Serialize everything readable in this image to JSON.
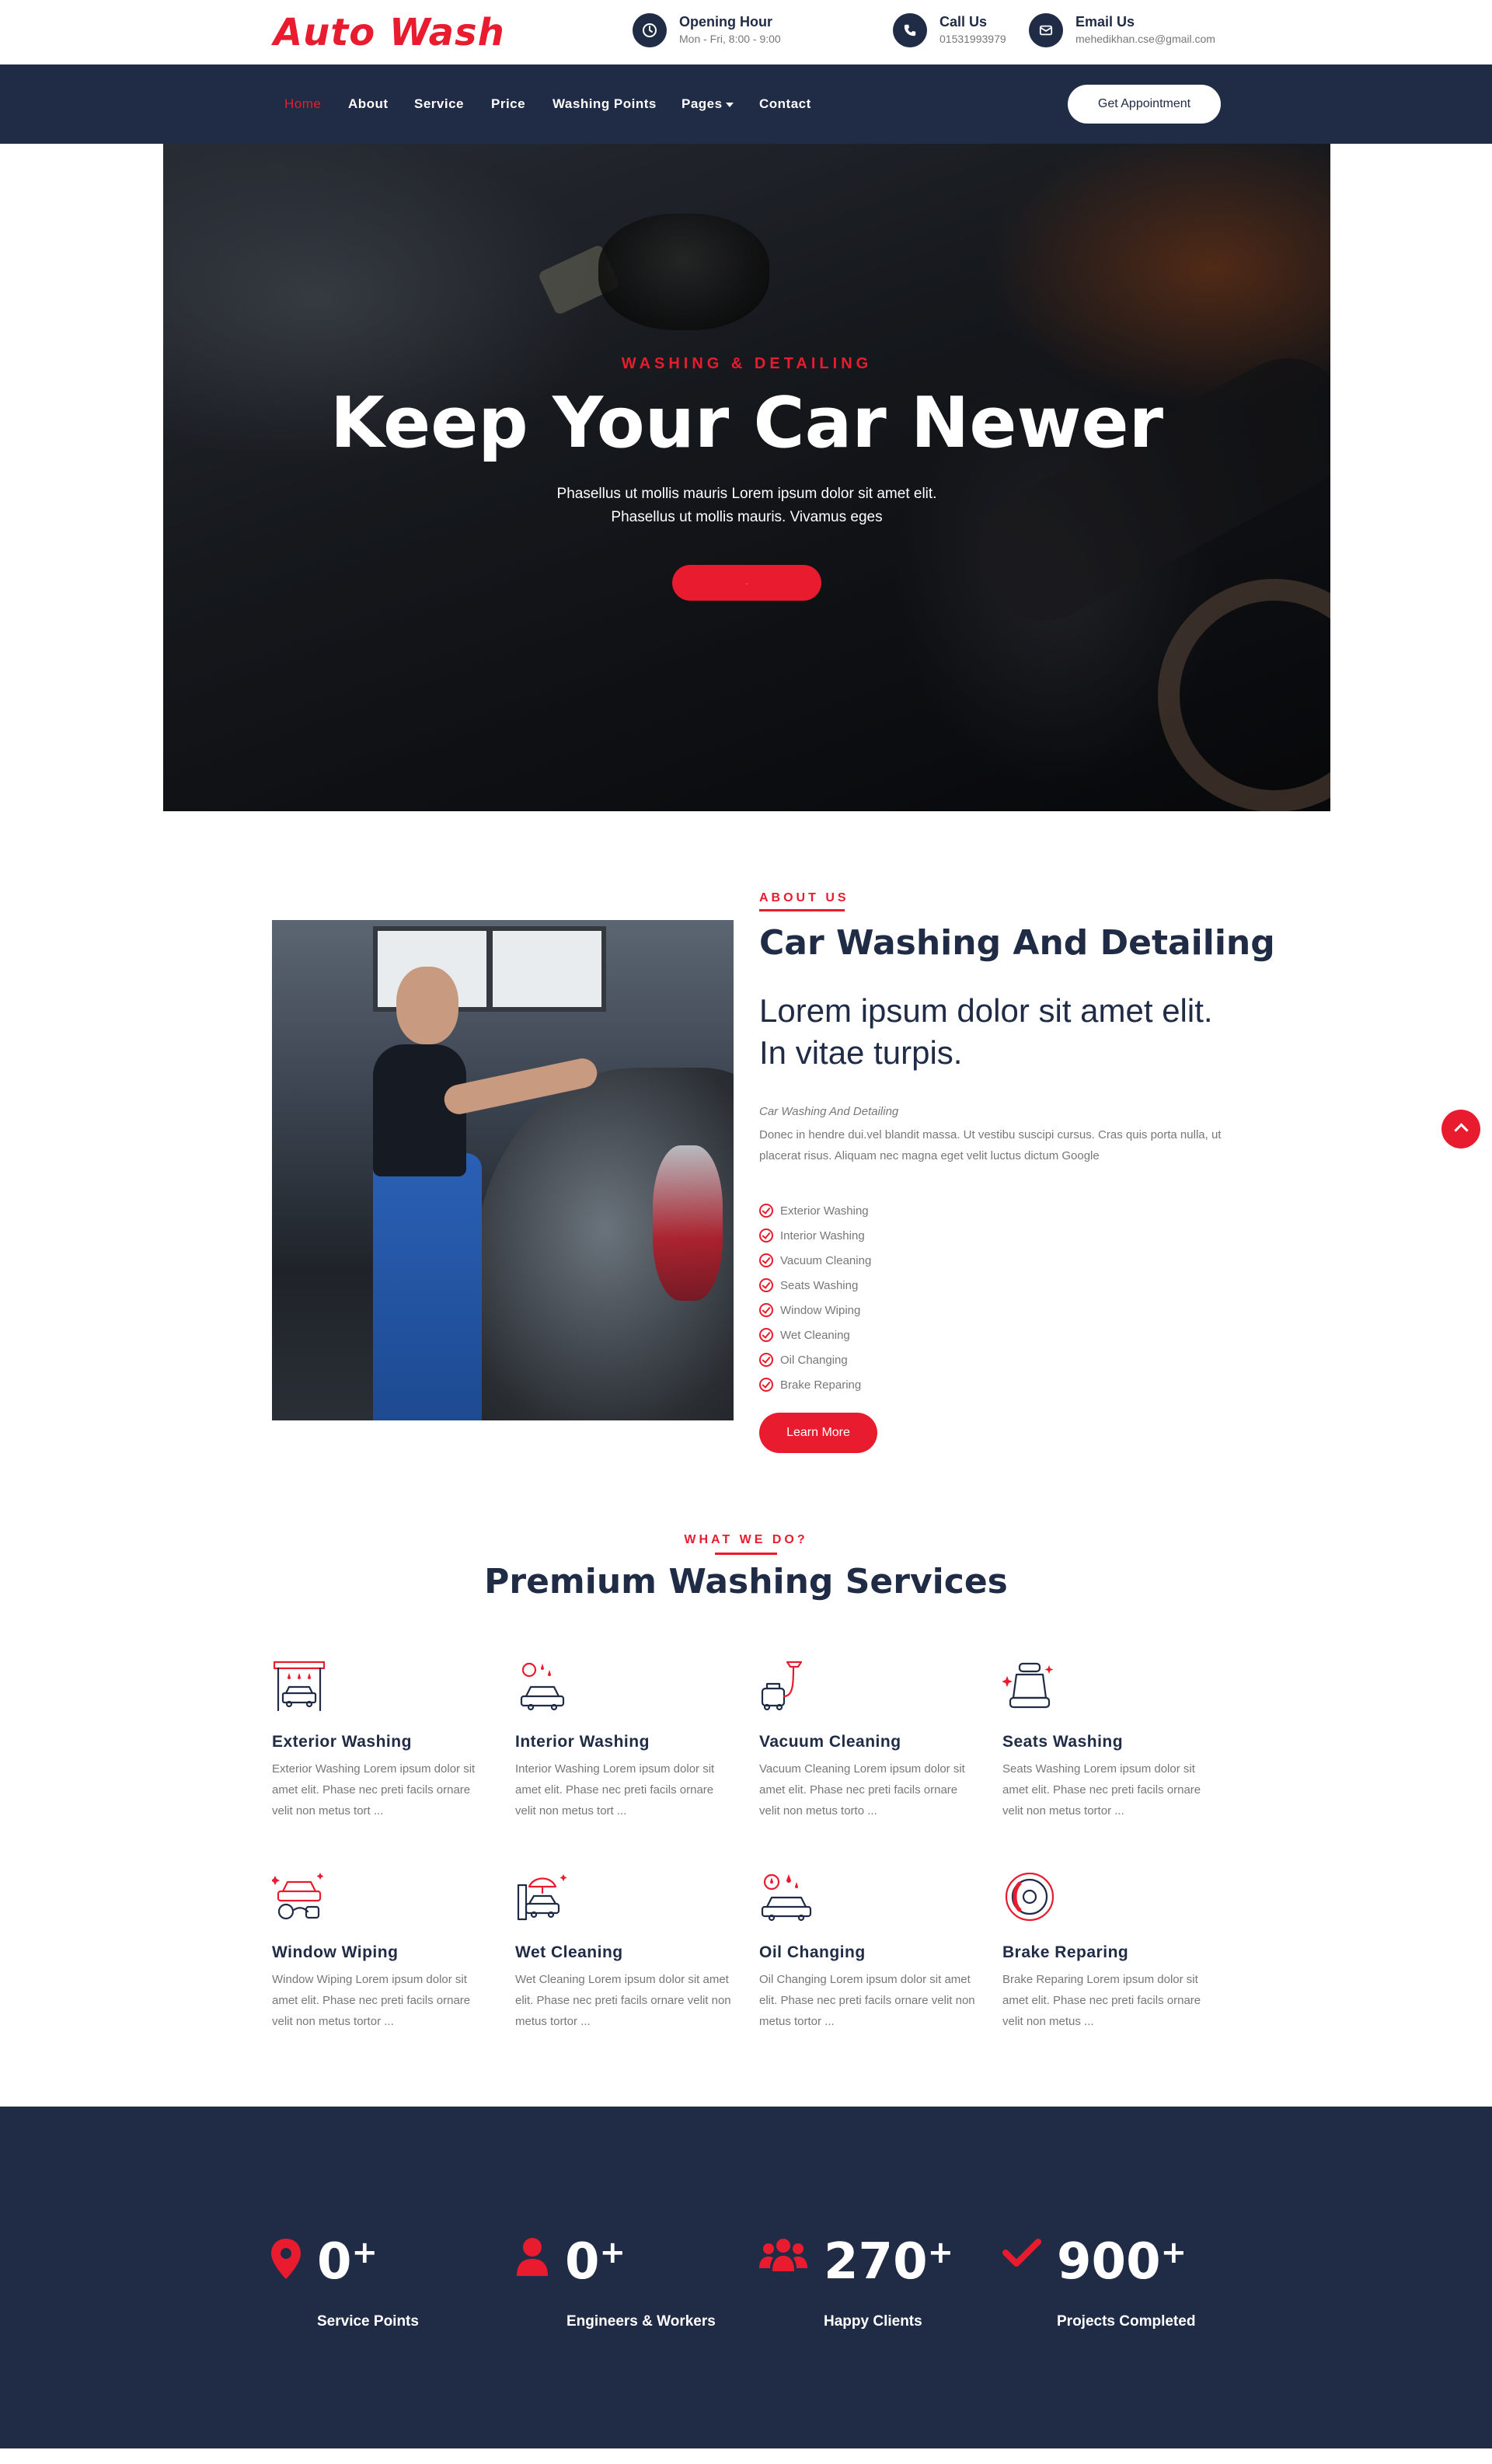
{
  "brand": {
    "logo": "Auto Wash",
    "accent": "#e81c2e",
    "navy": "#202c45"
  },
  "topbar": {
    "opening": {
      "title": "Opening Hour",
      "value": "Mon - Fri, 8:00 - 9:00",
      "icon": "clock-icon"
    },
    "call": {
      "title": "Call Us",
      "value": "01531993979",
      "icon": "phone-icon"
    },
    "email": {
      "title": "Email Us",
      "value": "mehedikhan.cse@gmail.com",
      "icon": "envelope-icon"
    }
  },
  "nav": {
    "items": [
      "Home",
      "About",
      "Service",
      "Price",
      "Washing Points",
      "Pages",
      "Contact"
    ],
    "active": "Home",
    "cta": "Get Appointment"
  },
  "hero": {
    "eyebrow": "WASHING & DETAILING",
    "title": "Keep Your Car Newer",
    "text_line1": "Phasellus ut mollis mauris Lorem ipsum dolor sit amet elit.",
    "text_line2": "Phasellus ut mollis mauris. Vivamus eges",
    "button": "."
  },
  "about": {
    "eyebrow": "ABOUT US",
    "title": "Car Washing And Detailing",
    "lead": "Lorem ipsum dolor sit amet elit. In vitae turpis.",
    "caption": "Car Washing And Detailing",
    "body": "Donec in hendre dui.vel blandit massa. Ut vestibu suscipi cursus. Cras quis porta nulla, ut placerat risus. Aliquam nec magna eget velit luctus dictum Google",
    "checklist": [
      "Exterior Washing",
      "Interior Washing",
      "Vacuum Cleaning",
      "Seats Washing",
      "Window Wiping",
      "Wet Cleaning",
      "Oil Changing",
      "Brake Reparing"
    ],
    "button": "Learn More"
  },
  "services": {
    "eyebrow": "WHAT WE DO?",
    "title": "Premium Washing Services",
    "items": [
      {
        "name": "Exterior Washing",
        "desc": "Exterior Washing Lorem ipsum dolor sit amet elit. Phase nec preti facils ornare velit non metus tort ...",
        "icon": "car-wash-station-icon"
      },
      {
        "name": "Interior Washing",
        "desc": "Interior Washing Lorem ipsum dolor sit amet elit. Phase nec preti facils ornare velit non metus tort ...",
        "icon": "car-interior-icon"
      },
      {
        "name": "Vacuum Cleaning",
        "desc": "Vacuum Cleaning Lorem ipsum dolor sit amet elit. Phase nec preti facils ornare velit non metus torto ...",
        "icon": "vacuum-icon"
      },
      {
        "name": "Seats Washing",
        "desc": "Seats Washing Lorem ipsum dolor sit amet elit. Phase nec preti facils ornare velit non metus tortor ...",
        "icon": "car-seat-icon"
      },
      {
        "name": "Window Wiping",
        "desc": "Window Wiping Lorem ipsum dolor sit amet elit. Phase nec preti facils ornare velit non metus tortor ...",
        "icon": "window-wiping-icon"
      },
      {
        "name": "Wet Cleaning",
        "desc": "Wet Cleaning Lorem ipsum dolor sit amet elit. Phase nec preti facils ornare velit non metus tortor ...",
        "icon": "wet-cleaning-icon"
      },
      {
        "name": "Oil Changing",
        "desc": "Oil Changing Lorem ipsum dolor sit amet elit. Phase nec preti facils ornare velit non metus tortor ...",
        "icon": "oil-changing-icon"
      },
      {
        "name": "Brake Reparing",
        "desc": "Brake Reparing Lorem ipsum dolor sit amet elit. Phase nec preti facils ornare velit non metus ...",
        "icon": "brake-icon"
      }
    ]
  },
  "stats": [
    {
      "value": "0",
      "suffix": "+",
      "label": "Service Points",
      "icon": "map-marker-icon"
    },
    {
      "value": "0",
      "suffix": "+",
      "label": "Engineers & Workers",
      "icon": "user-icon"
    },
    {
      "value": "270",
      "suffix": "+",
      "label": "Happy Clients",
      "icon": "users-icon"
    },
    {
      "value": "900",
      "suffix": "+",
      "label": "Projects Completed",
      "icon": "check-icon"
    }
  ]
}
